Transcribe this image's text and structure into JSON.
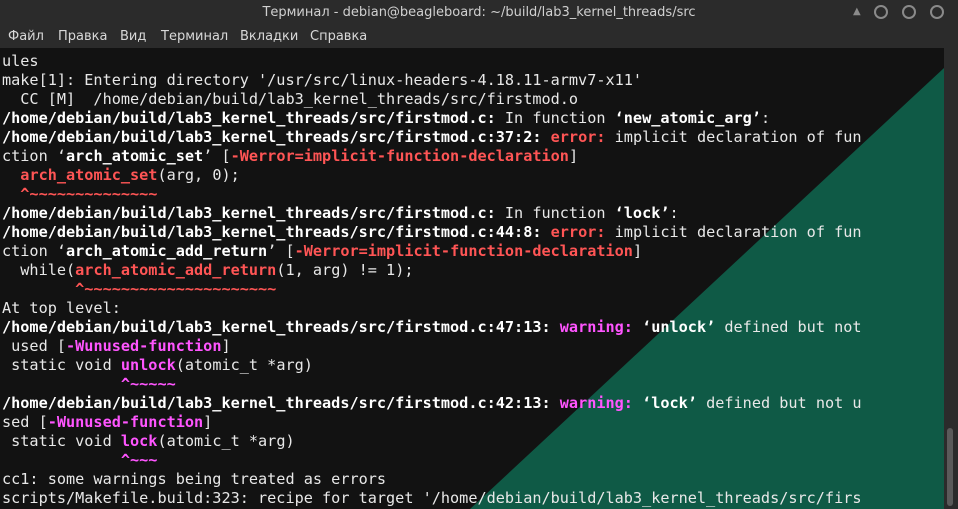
{
  "window": {
    "title": "Терминал - debian@beagleboard: ~/build/lab3_kernel_threads/src"
  },
  "menu": [
    "Файл",
    "Правка",
    "Вид",
    "Терминал",
    "Вкладки",
    "Справка"
  ],
  "colors": {
    "error": "#ff5555",
    "warning": "#ff55ff",
    "text": "#e8e8e8",
    "accent_stripe": "#0f5a46"
  },
  "lines": [
    [
      [
        "ules",
        ""
      ]
    ],
    [
      [
        "make[1]: Entering directory '/usr/src/linux-headers-4.18.11-armv7-x11'",
        ""
      ]
    ],
    [
      [
        "  CC [M]  /home/debian/build/lab3_kernel_threads/src/firstmod.o",
        ""
      ]
    ],
    [
      [
        "/home/debian/build/lab3_kernel_threads/src/firstmod.c:",
        "b"
      ],
      [
        " In function ",
        ""
      ],
      [
        "‘new_atomic_arg’",
        "b"
      ],
      [
        ":",
        ""
      ]
    ],
    [
      [
        "/home/debian/build/lab3_kernel_threads/src/firstmod.c:37:2:",
        "b"
      ],
      [
        " ",
        ""
      ],
      [
        "error:",
        "r"
      ],
      [
        " implicit declaration of fun",
        ""
      ]
    ],
    [
      [
        "ction ‘",
        ""
      ],
      [
        "arch_atomic_set",
        "b"
      ],
      [
        "’ [",
        ""
      ],
      [
        "-Werror=implicit-function-declaration",
        "r"
      ],
      [
        "]",
        ""
      ]
    ],
    [
      [
        "  ",
        ""
      ],
      [
        "arch_atomic_set",
        "r"
      ],
      [
        "(arg, 0);",
        ""
      ]
    ],
    [
      [
        "  ^~~~~~~~~~~~~~~",
        "r"
      ]
    ],
    [
      [
        "/home/debian/build/lab3_kernel_threads/src/firstmod.c:",
        "b"
      ],
      [
        " In function ",
        ""
      ],
      [
        "‘lock’",
        "b"
      ],
      [
        ":",
        ""
      ]
    ],
    [
      [
        "/home/debian/build/lab3_kernel_threads/src/firstmod.c:44:8:",
        "b"
      ],
      [
        " ",
        ""
      ],
      [
        "error:",
        "r"
      ],
      [
        " implicit declaration of fun",
        ""
      ]
    ],
    [
      [
        "ction ‘",
        ""
      ],
      [
        "arch_atomic_add_return",
        "b"
      ],
      [
        "’ [",
        ""
      ],
      [
        "-Werror=implicit-function-declaration",
        "r"
      ],
      [
        "]",
        ""
      ]
    ],
    [
      [
        "  while(",
        ""
      ],
      [
        "arch_atomic_add_return",
        "r"
      ],
      [
        "(1, arg) != 1);",
        ""
      ]
    ],
    [
      [
        "        ^~~~~~~~~~~~~~~~~~~~~~",
        "r"
      ]
    ],
    [
      [
        "At top level:",
        ""
      ]
    ],
    [
      [
        "/home/debian/build/lab3_kernel_threads/src/firstmod.c:47:13:",
        "b"
      ],
      [
        " ",
        ""
      ],
      [
        "warning:",
        "m"
      ],
      [
        " ",
        ""
      ],
      [
        "‘unlock’",
        "b"
      ],
      [
        " defined but not",
        ""
      ]
    ],
    [
      [
        " used [",
        ""
      ],
      [
        "-Wunused-function",
        "m"
      ],
      [
        "]",
        ""
      ]
    ],
    [
      [
        " static void ",
        ""
      ],
      [
        "unlock",
        "m"
      ],
      [
        "(atomic_t *arg)",
        ""
      ]
    ],
    [
      [
        "             ^~~~~~",
        "m"
      ]
    ],
    [
      [
        "/home/debian/build/lab3_kernel_threads/src/firstmod.c:42:13:",
        "b"
      ],
      [
        " ",
        ""
      ],
      [
        "warning:",
        "m"
      ],
      [
        " ",
        ""
      ],
      [
        "‘lock’",
        "b"
      ],
      [
        " defined but not u",
        ""
      ]
    ],
    [
      [
        "sed [",
        ""
      ],
      [
        "-Wunused-function",
        "m"
      ],
      [
        "]",
        ""
      ]
    ],
    [
      [
        " static void ",
        ""
      ],
      [
        "lock",
        "m"
      ],
      [
        "(atomic_t *arg)",
        ""
      ]
    ],
    [
      [
        "             ^~~~",
        "m"
      ]
    ],
    [
      [
        "cc1: some warnings being treated as errors",
        ""
      ]
    ],
    [
      [
        "scripts/Makefile.build:323: recipe for target '/home/debian/build/lab3_kernel_threads/src/firs",
        ""
      ]
    ]
  ]
}
